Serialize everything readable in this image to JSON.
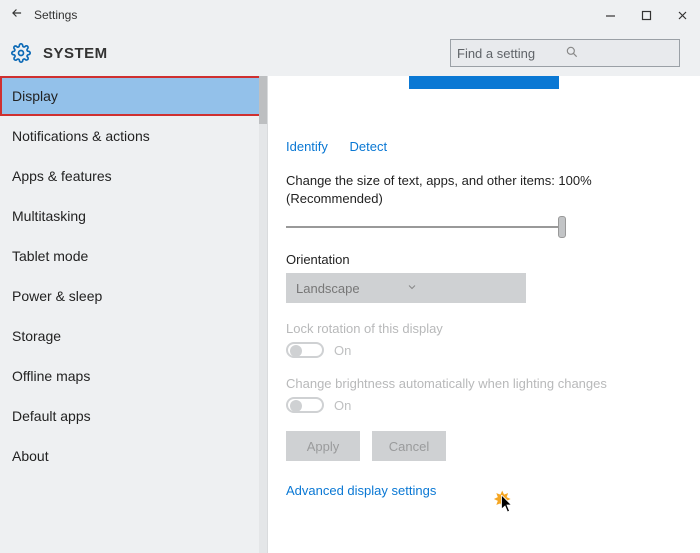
{
  "titlebar": {
    "title": "Settings"
  },
  "header": {
    "system": "SYSTEM"
  },
  "search": {
    "placeholder": "Find a setting"
  },
  "sidebar": {
    "items": [
      "Display",
      "Notifications & actions",
      "Apps & features",
      "Multitasking",
      "Tablet mode",
      "Power & sleep",
      "Storage",
      "Offline maps",
      "Default apps",
      "About"
    ]
  },
  "content": {
    "identify": "Identify",
    "detect": "Detect",
    "scale_text": "Change the size of text, apps, and other items: 100% (Recommended)",
    "orientation_label": "Orientation",
    "orientation_value": "Landscape",
    "lock_rotation_label": "Lock rotation of this display",
    "toggle_on": "On",
    "brightness_label": "Change brightness automatically when lighting changes",
    "apply": "Apply",
    "cancel": "Cancel",
    "advanced": "Advanced display settings"
  }
}
